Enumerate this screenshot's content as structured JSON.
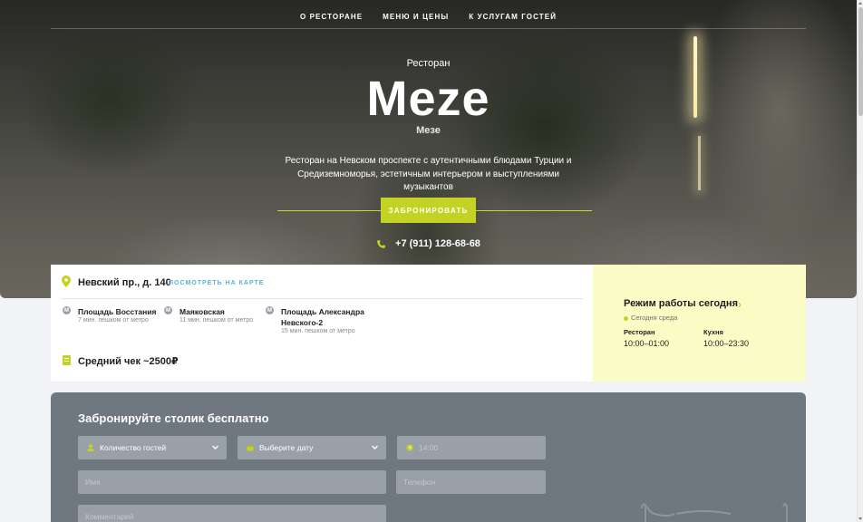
{
  "nav": {
    "items": [
      {
        "label": "О ресторане"
      },
      {
        "label": "Меню и цены"
      },
      {
        "label": "К услугам гостей"
      }
    ]
  },
  "hero": {
    "kicker": "Ресторан",
    "title": "Meze",
    "subtitle": "Мезе",
    "description": "Ресторан на Невском проспекте с аутентичными блюдами Турции и Средиземноморья, эстетичным интерьером и выступлениями музыкантов",
    "book_button": "Забронировать",
    "phone": "+7 (911) 128-68-68"
  },
  "info": {
    "address": "Невский пр., д. 140",
    "map_link": "Посмотреть на карте",
    "metro": [
      {
        "name": "Площадь Восстания",
        "time": "7 мин. пешком от метро"
      },
      {
        "name": "Маяковская",
        "time": "11 мин. пешком от метро"
      },
      {
        "name": "Площадь Александра Невского-2",
        "time": "15 мин. пешком от метро"
      }
    ],
    "average_check": "Средний чек ~2500₽"
  },
  "hours": {
    "title": "Режим работы сегодня",
    "today": "Сегодня среда",
    "restaurant_label": "Ресторан",
    "restaurant_hours": "10:00–01:00",
    "kitchen_label": "Кухня",
    "kitchen_hours": "10:00–23:30"
  },
  "booking": {
    "title": "Забронируйте столик бесплатно",
    "guests_placeholder": "Количество гостей",
    "date_placeholder": "Выберите дату",
    "time_value": "14:00",
    "name_placeholder": "Имя",
    "phone_placeholder": "Телефон",
    "comment_placeholder": "Комментарий"
  },
  "colors": {
    "accent": "#c4d323",
    "link": "#58b3d8",
    "hours_bg": "#fbfcc5",
    "booking_bg": "#6f7780"
  }
}
